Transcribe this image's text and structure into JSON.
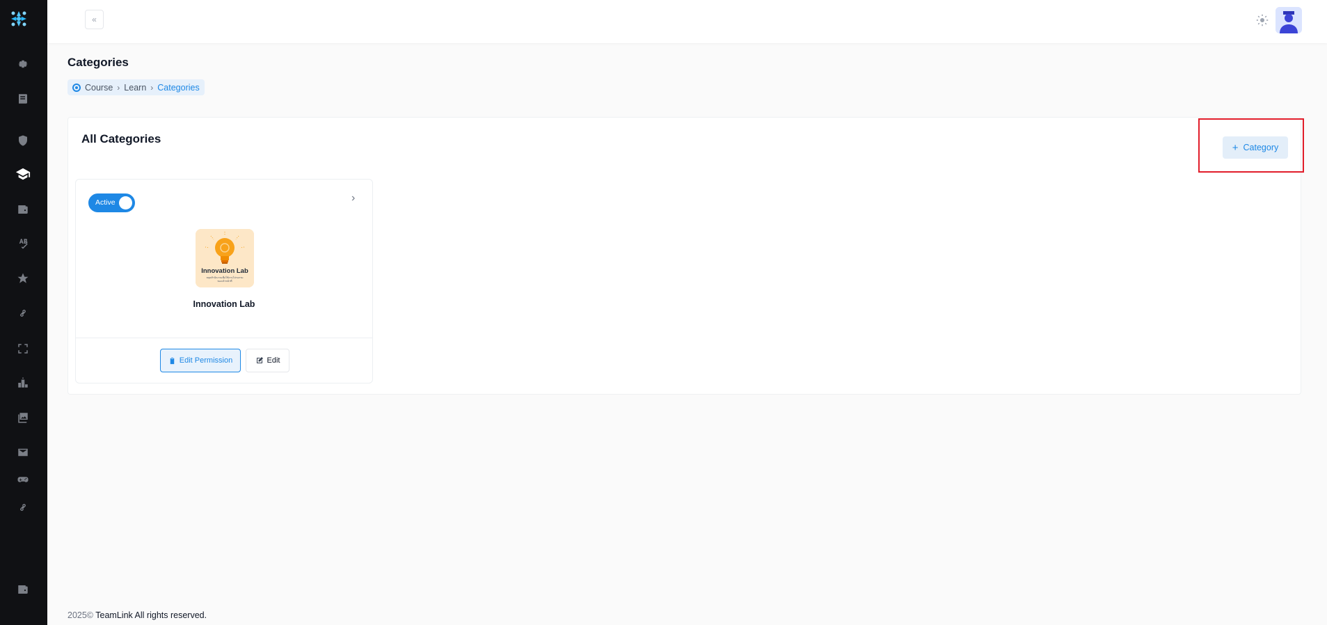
{
  "header": {
    "page_title": "Categories"
  },
  "breadcrumb": {
    "items": [
      "Course",
      "Learn"
    ],
    "current": "Categories"
  },
  "section": {
    "title": "All Categories",
    "add_button_label": "Category"
  },
  "categories": [
    {
      "status_label": "Active",
      "name": "Innovation Lab",
      "image_title": "Innovation Lab",
      "image_subtitle_1": "หลุดสำนักงานเพื่อใช้งานโปรแกรม",
      "image_subtitle_2": "ของเจ้าหน้าที่",
      "edit_permission_label": "Edit Permission",
      "edit_label": "Edit"
    }
  ],
  "footer": {
    "year": "2025©",
    "text": "TeamLink All rights reserved."
  },
  "colors": {
    "accent": "#1e88e5",
    "sidebar_bg": "#101114",
    "highlight": "#e11d2a"
  },
  "sidebar_icons": [
    "gear-icon",
    "book-icon",
    "shield-icon",
    "graduation-cap-icon",
    "wallet-icon",
    "spellcheck-icon",
    "star-icon",
    "link-icon",
    "fullscreen-icon",
    "leaderboard-icon",
    "gallery-icon",
    "mail-icon",
    "gamepad-icon",
    "link-icon",
    "wallet-icon"
  ]
}
